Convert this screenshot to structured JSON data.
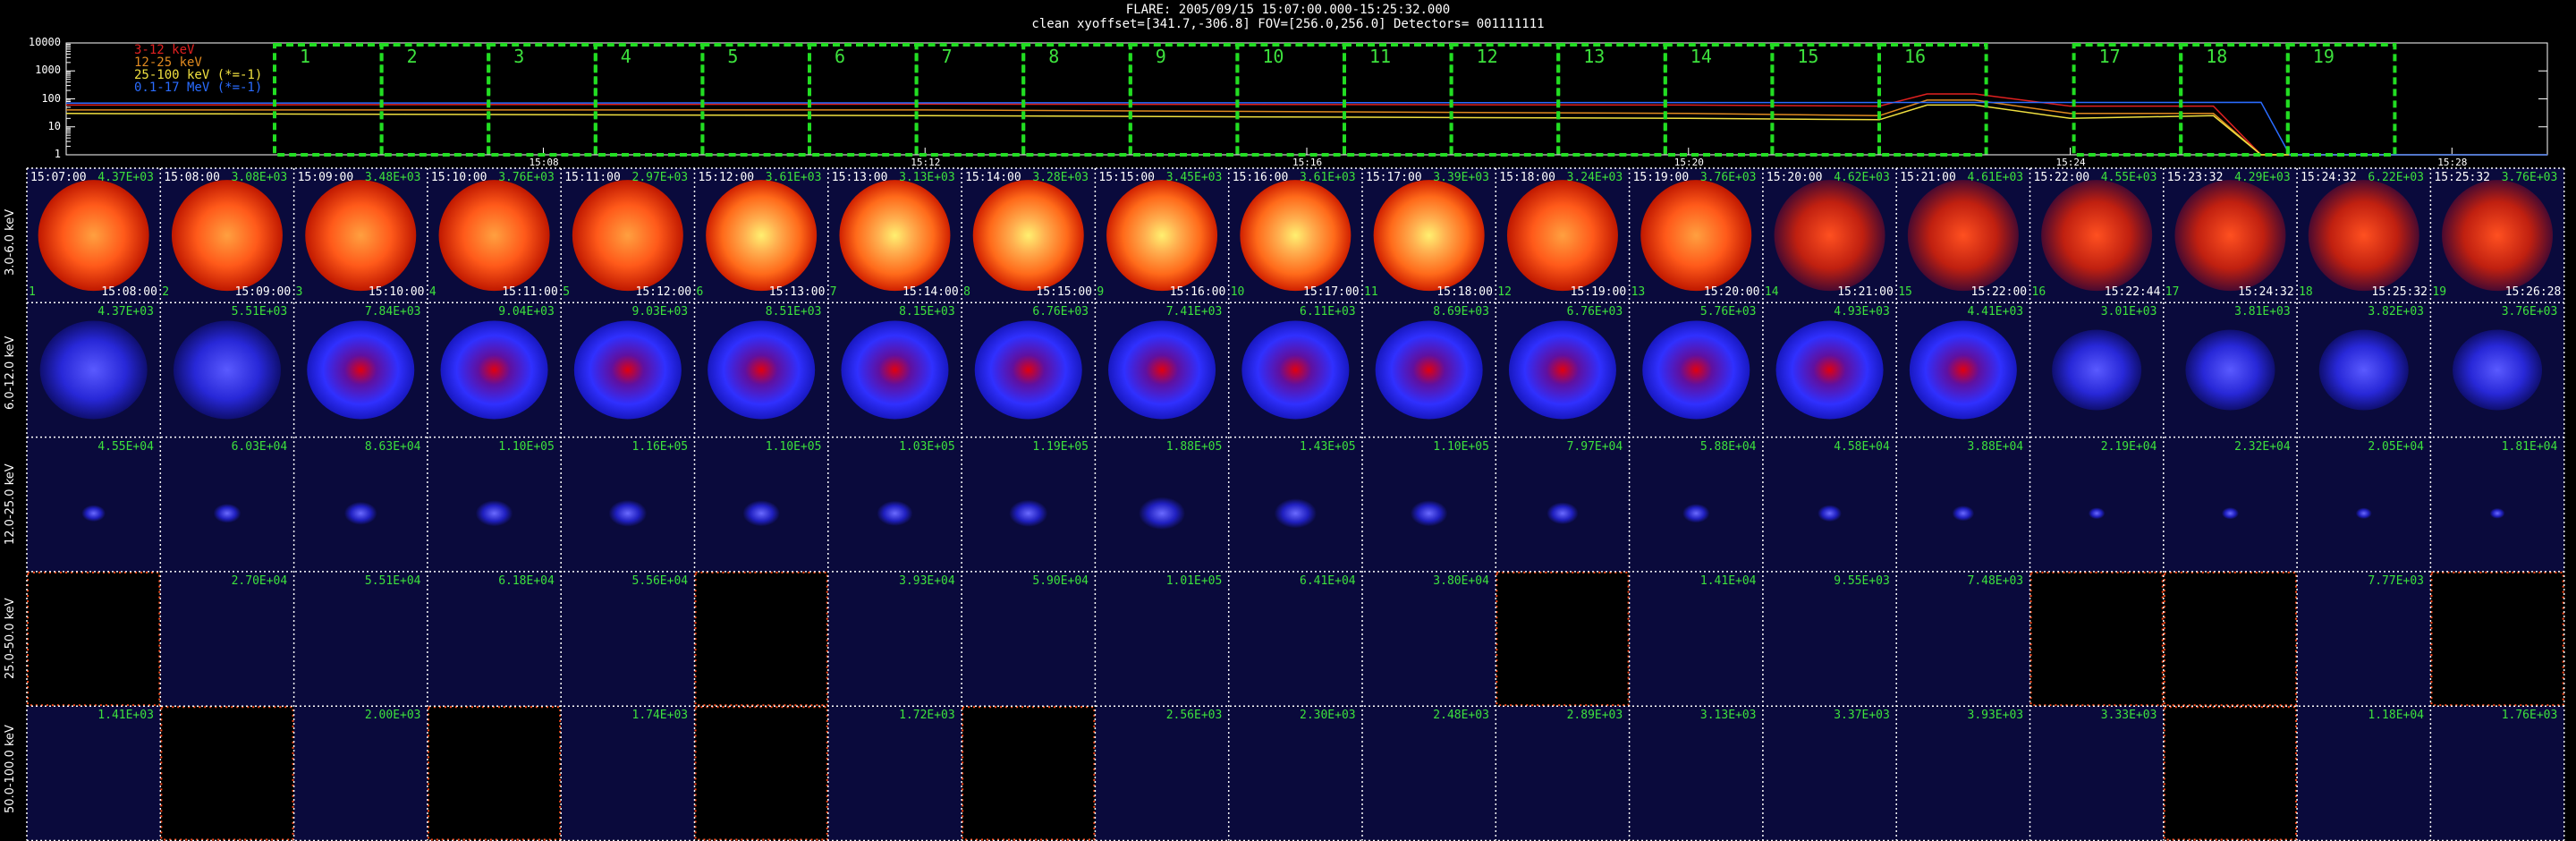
{
  "header": {
    "line1": "FLARE: 2005/09/15 15:07:00.000-15:25:32.000",
    "line2": "clean    xyoffset=[341.7,-306.8]  FOV=[256.0,256.0]   Detectors= 001111111"
  },
  "lightcurve": {
    "legend": [
      {
        "label": "3-12 keV",
        "color": "#e02020"
      },
      {
        "label": "12-25 keV",
        "color": "#e08a20"
      },
      {
        "label": "25-100 keV (*=-1)",
        "color": "#f0e040"
      },
      {
        "label": "0.1-17 MeV (*=-1)",
        "color": "#2a6cff"
      }
    ],
    "y_ticks": [
      "10000",
      "1000",
      "100",
      "10",
      "1"
    ],
    "x_ticks": [
      "15:08",
      "15:12",
      "15:16",
      "15:20",
      "15:24",
      "15:28"
    ],
    "interval_numbers": [
      "1",
      "2",
      "3",
      "4",
      "5",
      "6",
      "7",
      "8",
      "9",
      "10",
      "11",
      "12",
      "13",
      "14",
      "15",
      "16",
      "17",
      "18",
      "19"
    ],
    "gap_after_interval": 16,
    "chart_data": {
      "type": "line",
      "y_scale": "log",
      "ylim": [
        1,
        10000
      ],
      "xlim": [
        "15:03",
        "15:29"
      ],
      "series": [
        {
          "name": "3-12 keV",
          "x": [
            "15:03",
            "15:12",
            "15:20",
            "15:22",
            "15:22.5",
            "15:23",
            "15:24",
            "15:25.5",
            "15:26",
            "15:29"
          ],
          "y": [
            60,
            65,
            60,
            55,
            150,
            150,
            55,
            55,
            1,
            1
          ]
        },
        {
          "name": "12-25 keV",
          "x": [
            "15:03",
            "15:12",
            "15:20",
            "15:22",
            "15:22.5",
            "15:23",
            "15:24",
            "15:25.5",
            "15:26",
            "15:29"
          ],
          "y": [
            40,
            40,
            30,
            25,
            90,
            90,
            30,
            30,
            1,
            1
          ]
        },
        {
          "name": "25-100 keV (*=-1)",
          "x": [
            "15:03",
            "15:12",
            "15:20",
            "15:22",
            "15:22.5",
            "15:23",
            "15:24",
            "15:25.5",
            "15:26",
            "15:29"
          ],
          "y": [
            30,
            25,
            20,
            18,
            60,
            60,
            20,
            25,
            1,
            1
          ]
        },
        {
          "name": "0.1-17 MeV (*=-1)",
          "x": [
            "15:03",
            "15:26",
            "15:26.3",
            "15:29"
          ],
          "y": [
            70,
            75,
            1,
            1
          ]
        }
      ]
    }
  },
  "bands": [
    "3.0-6.0 keV",
    "6.0-12.0 keV",
    "12.0-25.0 keV",
    "25.0-50.0 keV",
    "50.0-100.0 keV"
  ],
  "times_start": [
    "15:07:00",
    "15:08:00",
    "15:09:00",
    "15:10:00",
    "15:11:00",
    "15:12:00",
    "15:13:00",
    "15:14:00",
    "15:15:00",
    "15:16:00",
    "15:17:00",
    "15:18:00",
    "15:19:00",
    "15:20:00",
    "15:21:00",
    "15:22:00",
    "15:23:32",
    "15:24:32",
    "15:25:32"
  ],
  "times_end": [
    "15:08:00",
    "15:09:00",
    "15:10:00",
    "15:11:00",
    "15:12:00",
    "15:13:00",
    "15:14:00",
    "15:15:00",
    "15:16:00",
    "15:17:00",
    "15:18:00",
    "15:19:00",
    "15:20:00",
    "15:21:00",
    "15:22:00",
    "15:22:44",
    "15:24:32",
    "15:25:32",
    "15:26:28"
  ],
  "counts": [
    [
      "4.37E+03",
      "3.08E+03",
      "3.48E+03",
      "3.76E+03",
      "2.97E+03",
      "3.61E+03",
      "3.13E+03",
      "3.28E+03",
      "3.45E+03",
      "3.61E+03",
      "3.39E+03",
      "3.24E+03",
      "3.76E+03",
      "4.62E+03",
      "4.61E+03",
      "4.55E+03",
      "4.29E+03",
      "6.22E+03",
      "3.76E+03"
    ],
    [
      "4.37E+03",
      "5.51E+03",
      "7.84E+03",
      "9.04E+03",
      "9.03E+03",
      "8.51E+03",
      "8.15E+03",
      "6.76E+03",
      "7.41E+03",
      "6.11E+03",
      "8.69E+03",
      "6.76E+03",
      "5.76E+03",
      "4.93E+03",
      "4.41E+03",
      "3.01E+03",
      "3.81E+03",
      "3.82E+03",
      "3.76E+03"
    ],
    [
      "4.55E+04",
      "6.03E+04",
      "8.63E+04",
      "1.10E+05",
      "1.16E+05",
      "1.10E+05",
      "1.03E+05",
      "1.19E+05",
      "1.88E+05",
      "1.43E+05",
      "1.10E+05",
      "7.97E+04",
      "5.88E+04",
      "4.58E+04",
      "3.88E+04",
      "2.19E+04",
      "2.32E+04",
      "2.05E+04",
      "1.81E+04"
    ],
    [
      "",
      "2.70E+04",
      "5.51E+04",
      "6.18E+04",
      "5.56E+04",
      "",
      "3.93E+04",
      "5.90E+04",
      "1.01E+05",
      "6.41E+04",
      "3.80E+04",
      "",
      "1.41E+04",
      "9.55E+03",
      "7.48E+03",
      "",
      "",
      "7.77E+03",
      ""
    ],
    [
      "1.41E+03",
      "",
      "2.00E+03",
      "",
      "1.74E+03",
      "",
      "1.72E+03",
      "",
      "2.56E+03",
      "2.30E+03",
      "2.48E+03",
      "2.89E+03",
      "3.13E+03",
      "3.37E+03",
      "3.93E+03",
      "3.33E+03",
      "",
      "1.18E+04",
      "1.76E+03"
    ]
  ],
  "empty_tiles": {
    "3": [
      0,
      5,
      11,
      15,
      16,
      18
    ],
    "4": [
      1,
      3,
      5,
      7,
      16
    ]
  },
  "colors": {
    "band_palettes": [
      "hot",
      "blue",
      "blue",
      "blue",
      "blue"
    ],
    "empty_tile_border": "#ff4a1a",
    "dotted_grid": "#ffffff",
    "interval_box": "#22dd22",
    "count_text": "#3de13d"
  }
}
